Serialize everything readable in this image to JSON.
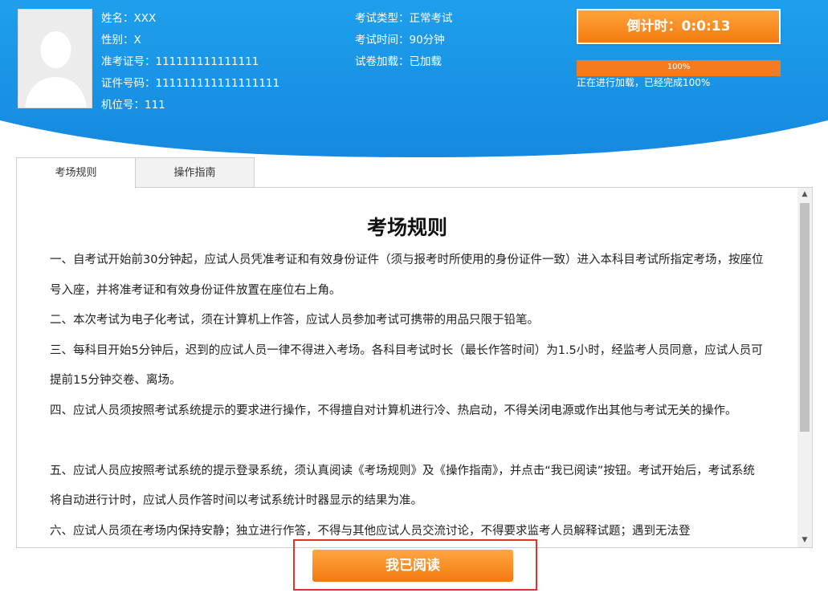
{
  "candidate": {
    "name_label": "姓名：XXX",
    "gender_label": "性别：X",
    "ticket_label": "准考证号：111111111111111",
    "id_label": "证件号码：111111111111111111",
    "seat_label": "机位号：111"
  },
  "exam": {
    "type_label": "考试类型：正常考试",
    "duration_label": "考试时间：90分钟",
    "paper_label": "试卷加载：已加载"
  },
  "countdown": {
    "text": "倒计时：0:0:13"
  },
  "loading": {
    "percent_text": "100%",
    "progress": 1.0,
    "caption": "正在进行加载，已经完成100%"
  },
  "tabs": [
    {
      "label": "考场规则",
      "active": true
    },
    {
      "label": "操作指南",
      "active": false
    }
  ],
  "document": {
    "title": "考场规则",
    "paragraphs": [
      "一、自考试开始前30分钟起，应试人员凭准考证和有效身份证件（须与报考时所使用的身份证件一致）进入本科目考试所指定考场，按座位号入座，并将准考证和有效身份证件放置在座位右上角。",
      "二、本次考试为电子化考试，须在计算机上作答，应试人员参加考试可携带的用品只限于铅笔。",
      "三、每科目开始5分钟后，迟到的应试人员一律不得进入考场。各科目考试时长（最长作答时间）为1.5小时，经监考人员同意，应试人员可提前15分钟交卷、离场。",
      "四、应试人员须按照考试系统提示的要求进行操作，不得擅自对计算机进行冷、热启动，不得关闭电源或作出其他与考试无关的操作。",
      "五、应试人员应按照考试系统的提示登录系统，须认真阅读《考场规则》及《操作指南》，并点击“我已阅读”按钮。考试开始后，考试系统将自动进行计时，应试人员作答时间以考试系统计时器显示的结果为准。",
      "六、应试人员须在考场内保持安静；独立进行作答，不得与其他应试人员交流讨论，不得要求监考人员解释试题；遇到无法登"
    ]
  },
  "actions": {
    "read_button": "我已阅读"
  },
  "colors": {
    "header_blue": "#1a9ae8",
    "accent_orange": "#f47b20",
    "highlight_red": "#e53030"
  }
}
